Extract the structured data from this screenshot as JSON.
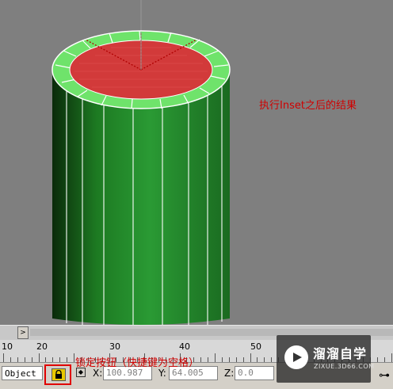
{
  "viewport": {
    "annotation_result": "执行Inset之后的结果"
  },
  "timeslider": {
    "arrow_label": ">"
  },
  "ruler": {
    "numbers": [
      "10",
      "20",
      "30",
      "40",
      "50"
    ]
  },
  "status_bar": {
    "selection_label": "Object",
    "lock_annotation": "锁定按钮（快捷键为空格）",
    "x_label": "X:",
    "x_value": "100.987",
    "y_label": "Y:",
    "y_value": "64.005",
    "z_label": "Z:",
    "z_value": "0.0"
  },
  "watermark": {
    "title": "溜溜自学",
    "subtitle": "ZIXUE.3D66.COM"
  },
  "icons": [
    "lock-icon",
    "absolute-mode-icon",
    "key-icon",
    "play-logo-icon"
  ],
  "colors": {
    "cylinder_body": "#1f8a2a",
    "inset_ring": "#6ee06a",
    "selected_face": "#d23a3a",
    "annotation": "#d00000"
  }
}
